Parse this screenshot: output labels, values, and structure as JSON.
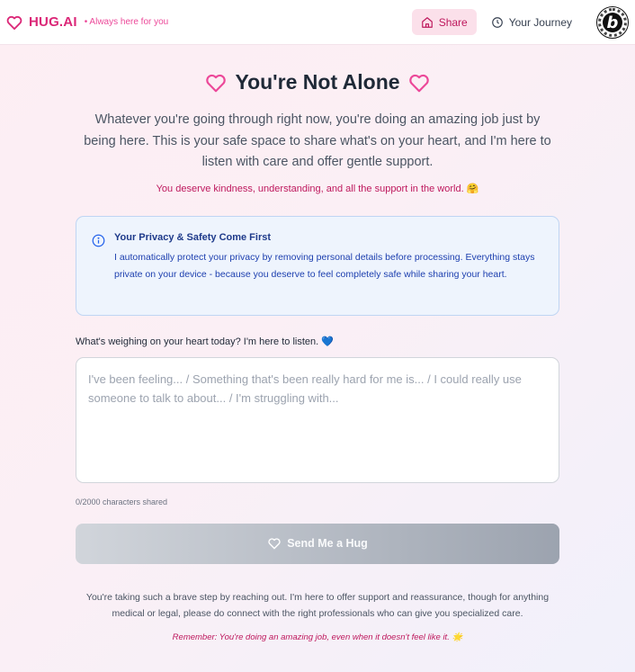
{
  "header": {
    "brand_name": "HUG.AI",
    "brand_tagline": "• Always here for you",
    "nav": [
      {
        "label": "Share",
        "icon": "home-icon",
        "active": true
      },
      {
        "label": "Your Journey",
        "icon": "clock-icon",
        "active": false
      }
    ],
    "badge_letter": "b"
  },
  "main": {
    "title": "You're Not Alone",
    "intro": "Whatever you're going through right now, you're doing an amazing job just by being here. This is your safe space to share what's on your heart, and I'm here to listen with care and offer gentle support.",
    "affirmation": "You deserve kindness, understanding, and all the support in the world. 🤗",
    "privacy": {
      "title": "Your Privacy & Safety Come First",
      "body": "I automatically protect your privacy by removing personal details before processing. Everything stays private on your device - because you deserve to feel completely safe while sharing your heart."
    },
    "prompt_label": "What's weighing on your heart today? I'm here to listen. 💙",
    "textarea": {
      "value": "",
      "placeholder": "I've been feeling... / Something that's been really hard for me is... / I could really use someone to talk to about... / I'm struggling with..."
    },
    "counter": "0/2000 characters shared",
    "send_label": "Send Me a Hug",
    "footer_text": "You're taking such a brave step by reaching out. I'm here to offer support and reassurance, though for anything medical or legal, please do connect with the right professionals who can give you specialized care.",
    "footer_remind": "Remember: You're doing an amazing job, even when it doesn't feel like it. 🌟"
  },
  "colors": {
    "brand": "#db2777",
    "accent_pink": "#ec4899",
    "info_blue": "#2563eb",
    "button_disabled_start": "#d1d5db",
    "button_disabled_end": "#9ca3af"
  }
}
